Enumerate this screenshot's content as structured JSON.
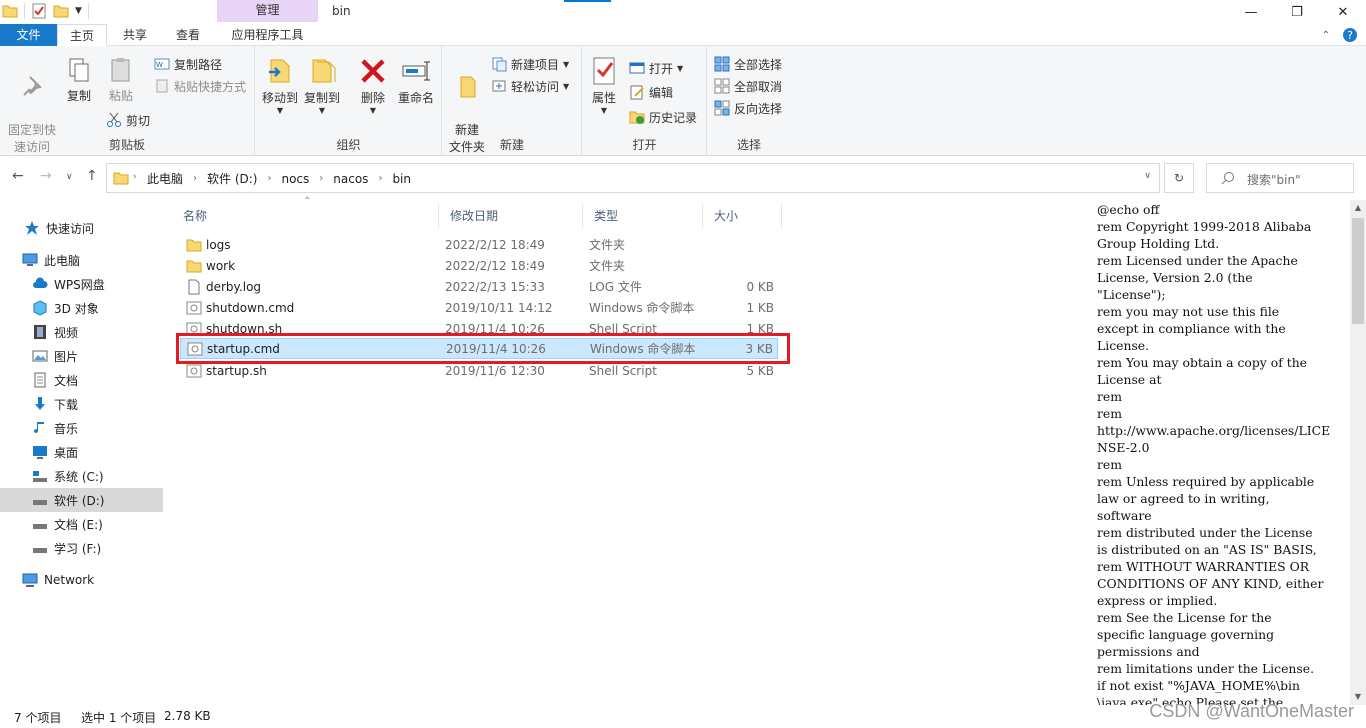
{
  "window": {
    "title": "bin",
    "context_tab": "管理"
  },
  "ribbon_tabs": {
    "file": "文件",
    "home": "主页",
    "share": "共享",
    "view": "查看",
    "app_tools": "应用程序工具"
  },
  "ribbon": {
    "clipboard": {
      "label": "剪贴板",
      "pin": "固定到快\n速访问",
      "copy": "复制",
      "paste": "粘贴",
      "copy_path": "复制路径",
      "paste_shortcut": "粘贴快捷方式",
      "cut": "剪切"
    },
    "organize": {
      "label": "组织",
      "move_to": "移动到",
      "copy_to": "复制到",
      "delete": "删除",
      "rename": "重命名"
    },
    "new": {
      "label": "新建",
      "new_folder": "新建\n文件夹",
      "new_item": "新建项目",
      "easy_access": "轻松访问"
    },
    "open": {
      "label": "打开",
      "properties": "属性",
      "open": "打开",
      "edit": "编辑",
      "history": "历史记录"
    },
    "select": {
      "label": "选择",
      "select_all": "全部选择",
      "select_none": "全部取消",
      "invert": "反向选择"
    }
  },
  "address": {
    "crumbs": [
      "此电脑",
      "软件 (D:)",
      "nocs",
      "nacos",
      "bin"
    ],
    "search_placeholder": "搜索\"bin\""
  },
  "nav": {
    "quick_access": "快速访问",
    "this_pc": "此电脑",
    "items": [
      "WPS网盘",
      "3D 对象",
      "视频",
      "图片",
      "文档",
      "下载",
      "音乐",
      "桌面",
      "系统 (C:)",
      "软件 (D:)",
      "文档 (E:)",
      "学习 (F:)"
    ],
    "network": "Network"
  },
  "columns": {
    "name": "名称",
    "date": "修改日期",
    "type": "类型",
    "size": "大小"
  },
  "files": [
    {
      "name": "logs",
      "date": "2022/2/12 18:49",
      "type": "文件夹",
      "size": "",
      "kind": "folder"
    },
    {
      "name": "work",
      "date": "2022/2/12 18:49",
      "type": "文件夹",
      "size": "",
      "kind": "folder"
    },
    {
      "name": "derby.log",
      "date": "2022/2/13 15:33",
      "type": "LOG 文件",
      "size": "0 KB",
      "kind": "doc"
    },
    {
      "name": "shutdown.cmd",
      "date": "2019/10/11 14:12",
      "type": "Windows 命令脚本",
      "size": "1 KB",
      "kind": "script"
    },
    {
      "name": "shutdown.sh",
      "date": "2019/11/4 10:26",
      "type": "Shell Script",
      "size": "1 KB",
      "kind": "script"
    },
    {
      "name": "startup.cmd",
      "date": "2019/11/4 10:26",
      "type": "Windows 命令脚本",
      "size": "3 KB",
      "kind": "script",
      "selected": true
    },
    {
      "name": "startup.sh",
      "date": "2019/11/6 12:30",
      "type": "Shell Script",
      "size": "5 KB",
      "kind": "script"
    }
  ],
  "preview_lines": [
    "@echo off",
    "rem Copyright 1999-2018 Alibaba",
    "Group Holding Ltd.",
    "rem Licensed under the Apache",
    "License, Version 2.0 (the",
    "\"License\");",
    "rem you may not use this file",
    "except in compliance with the",
    "License.",
    "rem You may obtain a copy of the",
    "License at",
    "rem",
    "rem",
    "http://www.apache.org/licenses/LICE",
    "NSE-2.0",
    "rem",
    "rem Unless required by applicable",
    "law or agreed to in writing,",
    "software",
    "rem distributed under the License",
    "is distributed on an \"AS IS\" BASIS,",
    "rem WITHOUT WARRANTIES OR",
    "CONDITIONS OF ANY KIND, either",
    "express or implied.",
    "rem See the License for the",
    "specific language governing",
    "permissions and",
    "rem limitations under the License.",
    "if not exist \"%JAVA_HOME%\\bin",
    "\\java.exe\" echo Please set the"
  ],
  "status": {
    "count": "7 个项目",
    "selected": "选中 1 个项目",
    "size": "2.78 KB"
  },
  "watermark": "CSDN @WantOneMaster",
  "colors": {
    "accent": "#0078d7",
    "file_tab": "#1979ca",
    "context_tab": "#e8d4f4",
    "highlight_box": "#e51b24",
    "selection": "#cce8ff",
    "folder": "#f8d775"
  }
}
